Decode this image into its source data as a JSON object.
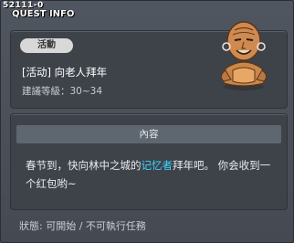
{
  "window": {
    "quest_id": "52111-0",
    "title": "QUEST INFO"
  },
  "quest": {
    "tag": "活動",
    "name": "[活动] 向老人拜年",
    "level": "建議等級：30~34",
    "npc_icon": "elder-npc-portrait"
  },
  "content": {
    "header": "內容",
    "text_before": "春节到，快向林中之城的",
    "highlight": "记忆者",
    "text_after": "拜年吧。 你会收到一个红包哟~",
    "highlight_color": "#39d8ff"
  },
  "status": {
    "text": "狀態: 可開始 / 不可執行任務"
  }
}
